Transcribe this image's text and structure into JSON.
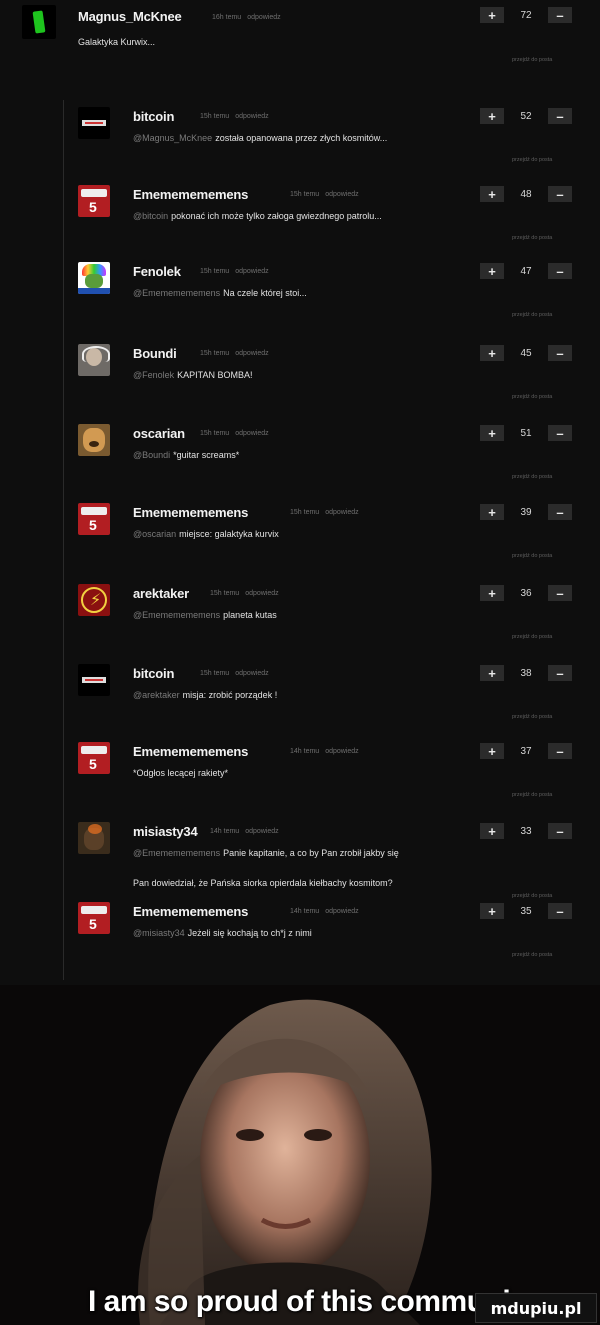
{
  "vote": {
    "plus": "+",
    "minus": "–"
  },
  "goto": "przejdź do posta",
  "top": {
    "user": "Magnus_McKnee",
    "time": "16h temu",
    "reply": "odpowiedz",
    "score": "72",
    "text": "Galaktyka Kurwix..."
  },
  "comments": [
    {
      "user": "bitcoin",
      "time": "15h temu",
      "reply": "odpowiedz",
      "score": "52",
      "mention": "@Magnus_McKnee",
      "text": "została opanowana przez złych kosmitów..."
    },
    {
      "user": "Emememememens",
      "time": "15h temu",
      "reply": "odpowiedz",
      "score": "48",
      "mention": "@bitcoin",
      "text": "pokonać ich może tylko załoga gwiezdnego patrolu..."
    },
    {
      "user": "Fenolek",
      "time": "15h temu",
      "reply": "odpowiedz",
      "score": "47",
      "mention": "@Emememememens",
      "text": "Na czele której stoi..."
    },
    {
      "user": "Boundi",
      "time": "15h temu",
      "reply": "odpowiedz",
      "score": "45",
      "mention": "@Fenolek",
      "text": "KAPITAN BOMBA!"
    },
    {
      "user": "oscarian",
      "time": "15h temu",
      "reply": "odpowiedz",
      "score": "51",
      "mention": "@Boundi",
      "text": "*guitar screams*"
    },
    {
      "user": "Emememememens",
      "time": "15h temu",
      "reply": "odpowiedz",
      "score": "39",
      "mention": "@oscarian",
      "text": "miejsce: galaktyka kurvix"
    },
    {
      "user": "arektaker",
      "time": "15h temu",
      "reply": "odpowiedz",
      "score": "36",
      "mention": "@Emememememens",
      "text": "planeta kutas"
    },
    {
      "user": "bitcoin",
      "time": "15h temu",
      "reply": "odpowiedz",
      "score": "38",
      "mention": "@arektaker",
      "text": "misja: zrobić porządek !"
    },
    {
      "user": "Emememememens",
      "time": "14h temu",
      "reply": "odpowiedz",
      "score": "37",
      "mention": "",
      "text": "*Odgłos lecącej rakiety*"
    },
    {
      "user": "misiasty34",
      "time": "14h temu",
      "reply": "odpowiedz",
      "score": "33",
      "mention": "@Emememememens",
      "text": "Panie kapitanie, a co by Pan zrobił jakby się",
      "text2": "Pan dowiedział, że Pańska siorka opierdala kiełbachy kosmitom?"
    },
    {
      "user": "Emememememens",
      "time": "14h temu",
      "reply": "odpowiedz",
      "score": "35",
      "mention": "@misiasty34",
      "text": "Jeżeli się kochają to ch*j z nimi"
    }
  ],
  "meme": {
    "caption": "I am so proud of this communi",
    "watermark": "mdupiu.pl"
  }
}
